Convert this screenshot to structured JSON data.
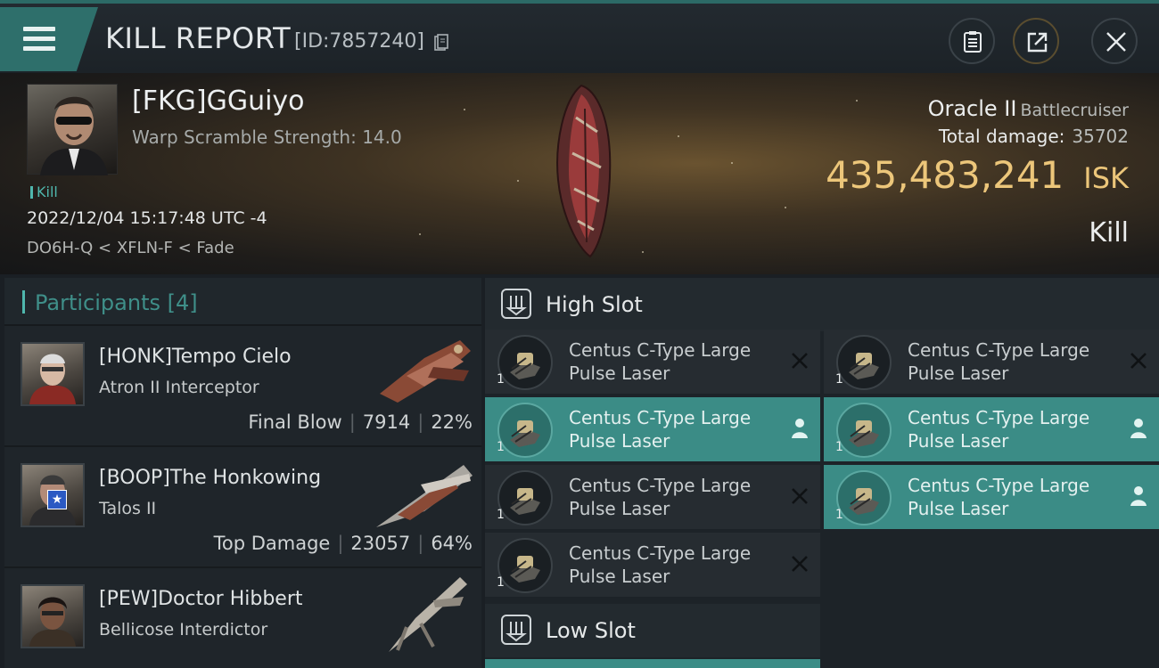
{
  "header": {
    "title": "KILL REPORT",
    "report_id": "[ID:7857240]"
  },
  "victim": {
    "name": "[FKG]GGuiyo",
    "warp_scramble": "Warp Scramble Strength: 14.0",
    "kill_tag": "Kill",
    "datetime": "2022/12/04 15:17:48 UTC -4",
    "location": "DO6H-Q < XFLN-F < Fade",
    "ship": "Oracle II",
    "ship_class": "Battlecruiser",
    "total_damage_label": "Total damage:",
    "total_damage": "35702",
    "isk_value": "435,483,241",
    "isk_unit": "ISK",
    "result": "Kill"
  },
  "participants": {
    "label": "Participants",
    "count": "[4]",
    "rows": [
      {
        "name": "[HONK]Tempo Cielo",
        "ship": "Atron II Interceptor",
        "role": "Final Blow",
        "damage": "7914",
        "percent": "22%"
      },
      {
        "name": "[BOOP]The Honkowing",
        "ship": "Talos II",
        "role": "Top Damage",
        "damage": "23057",
        "percent": "64%",
        "badge": "★"
      },
      {
        "name": "[PEW]Doctor Hibbert",
        "ship": "Bellicose Interdictor"
      }
    ]
  },
  "slots": {
    "high_label": "High Slot",
    "low_label": "Low Slot",
    "modules": [
      {
        "line1": "Centus C-Type Large",
        "line2": "Pulse Laser",
        "qty": "1",
        "state": "destroyed"
      },
      {
        "line1": "Centus C-Type Large",
        "line2": "Pulse Laser",
        "qty": "1",
        "state": "destroyed"
      },
      {
        "line1": "Centus C-Type Large",
        "line2": "Pulse Laser",
        "qty": "1",
        "state": "dropped"
      },
      {
        "line1": "Centus C-Type Large",
        "line2": "Pulse Laser",
        "qty": "1",
        "state": "dropped"
      },
      {
        "line1": "Centus C-Type Large",
        "line2": "Pulse Laser",
        "qty": "1",
        "state": "destroyed"
      },
      {
        "line1": "Centus C-Type Large",
        "line2": "Pulse Laser",
        "qty": "1",
        "state": "dropped"
      },
      {
        "line1": "Centus C-Type Large",
        "line2": "Pulse Laser",
        "qty": "1",
        "state": "destroyed"
      }
    ]
  },
  "colors": {
    "accent": "#3b8c86",
    "isk": "#ecc67a"
  }
}
